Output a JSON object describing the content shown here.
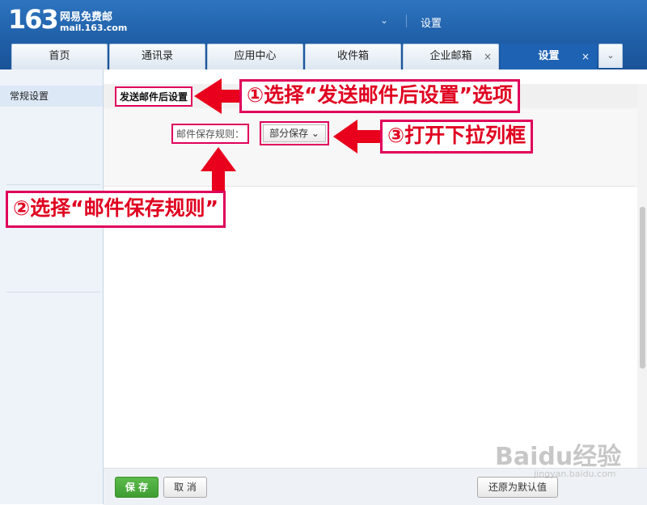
{
  "header": {
    "logo_number": "163",
    "logo_cn": "网易免费邮",
    "logo_domain": "mail.163.com",
    "dropdown_glyph": "⌄",
    "title": "设置"
  },
  "tabs": [
    {
      "label": "首页",
      "active": false
    },
    {
      "label": "通讯录",
      "active": false
    },
    {
      "label": "应用中心",
      "active": false
    },
    {
      "label": "收件箱",
      "active": false
    },
    {
      "label": "企业邮箱",
      "active": false,
      "closable": true
    },
    {
      "label": "设置",
      "active": true,
      "closable": true
    }
  ],
  "tab_close_glyph": "×",
  "tab_more_glyph": "⌄",
  "sidebar": {
    "items": [
      {
        "label": "常规设置",
        "selected": true
      }
    ]
  },
  "main": {
    "section_title": "发送邮件后设置",
    "rule_label": "邮件保存规则：",
    "rule_select_value": "部分保存 ⌄"
  },
  "buttons": {
    "save": "保 存",
    "cancel": "取 消",
    "restore_default": "还原为默认值"
  },
  "annotations": {
    "step1": "①选择“发送邮件后设置”选项",
    "step2": "②选择“邮件保存规则”",
    "step3": "③打开下拉列框"
  },
  "watermark": {
    "text": "Baidu经验",
    "sub": "jingyan.baidu.com"
  },
  "colors": {
    "header_blue": "#1f5ea7",
    "active_tab": "#1e62b3",
    "annotation_red": "#e00020",
    "save_green": "#45a636"
  }
}
